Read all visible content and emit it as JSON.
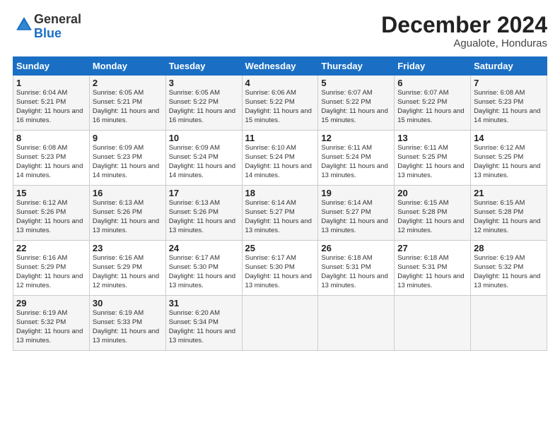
{
  "logo": {
    "general": "General",
    "blue": "Blue"
  },
  "header": {
    "month": "December 2024",
    "location": "Agualote, Honduras"
  },
  "weekdays": [
    "Sunday",
    "Monday",
    "Tuesday",
    "Wednesday",
    "Thursday",
    "Friday",
    "Saturday"
  ],
  "weeks": [
    [
      {
        "day": 1,
        "sunrise": "6:04 AM",
        "sunset": "5:21 PM",
        "daylight": "11 hours and 16 minutes."
      },
      {
        "day": 2,
        "sunrise": "6:05 AM",
        "sunset": "5:21 PM",
        "daylight": "11 hours and 16 minutes."
      },
      {
        "day": 3,
        "sunrise": "6:05 AM",
        "sunset": "5:22 PM",
        "daylight": "11 hours and 16 minutes."
      },
      {
        "day": 4,
        "sunrise": "6:06 AM",
        "sunset": "5:22 PM",
        "daylight": "11 hours and 15 minutes."
      },
      {
        "day": 5,
        "sunrise": "6:07 AM",
        "sunset": "5:22 PM",
        "daylight": "11 hours and 15 minutes."
      },
      {
        "day": 6,
        "sunrise": "6:07 AM",
        "sunset": "5:22 PM",
        "daylight": "11 hours and 15 minutes."
      },
      {
        "day": 7,
        "sunrise": "6:08 AM",
        "sunset": "5:23 PM",
        "daylight": "11 hours and 14 minutes."
      }
    ],
    [
      {
        "day": 8,
        "sunrise": "6:08 AM",
        "sunset": "5:23 PM",
        "daylight": "11 hours and 14 minutes."
      },
      {
        "day": 9,
        "sunrise": "6:09 AM",
        "sunset": "5:23 PM",
        "daylight": "11 hours and 14 minutes."
      },
      {
        "day": 10,
        "sunrise": "6:09 AM",
        "sunset": "5:24 PM",
        "daylight": "11 hours and 14 minutes."
      },
      {
        "day": 11,
        "sunrise": "6:10 AM",
        "sunset": "5:24 PM",
        "daylight": "11 hours and 14 minutes."
      },
      {
        "day": 12,
        "sunrise": "6:11 AM",
        "sunset": "5:24 PM",
        "daylight": "11 hours and 13 minutes."
      },
      {
        "day": 13,
        "sunrise": "6:11 AM",
        "sunset": "5:25 PM",
        "daylight": "11 hours and 13 minutes."
      },
      {
        "day": 14,
        "sunrise": "6:12 AM",
        "sunset": "5:25 PM",
        "daylight": "11 hours and 13 minutes."
      }
    ],
    [
      {
        "day": 15,
        "sunrise": "6:12 AM",
        "sunset": "5:26 PM",
        "daylight": "11 hours and 13 minutes."
      },
      {
        "day": 16,
        "sunrise": "6:13 AM",
        "sunset": "5:26 PM",
        "daylight": "11 hours and 13 minutes."
      },
      {
        "day": 17,
        "sunrise": "6:13 AM",
        "sunset": "5:26 PM",
        "daylight": "11 hours and 13 minutes."
      },
      {
        "day": 18,
        "sunrise": "6:14 AM",
        "sunset": "5:27 PM",
        "daylight": "11 hours and 13 minutes."
      },
      {
        "day": 19,
        "sunrise": "6:14 AM",
        "sunset": "5:27 PM",
        "daylight": "11 hours and 13 minutes."
      },
      {
        "day": 20,
        "sunrise": "6:15 AM",
        "sunset": "5:28 PM",
        "daylight": "11 hours and 12 minutes."
      },
      {
        "day": 21,
        "sunrise": "6:15 AM",
        "sunset": "5:28 PM",
        "daylight": "11 hours and 12 minutes."
      }
    ],
    [
      {
        "day": 22,
        "sunrise": "6:16 AM",
        "sunset": "5:29 PM",
        "daylight": "11 hours and 12 minutes."
      },
      {
        "day": 23,
        "sunrise": "6:16 AM",
        "sunset": "5:29 PM",
        "daylight": "11 hours and 12 minutes."
      },
      {
        "day": 24,
        "sunrise": "6:17 AM",
        "sunset": "5:30 PM",
        "daylight": "11 hours and 13 minutes."
      },
      {
        "day": 25,
        "sunrise": "6:17 AM",
        "sunset": "5:30 PM",
        "daylight": "11 hours and 13 minutes."
      },
      {
        "day": 26,
        "sunrise": "6:18 AM",
        "sunset": "5:31 PM",
        "daylight": "11 hours and 13 minutes."
      },
      {
        "day": 27,
        "sunrise": "6:18 AM",
        "sunset": "5:31 PM",
        "daylight": "11 hours and 13 minutes."
      },
      {
        "day": 28,
        "sunrise": "6:19 AM",
        "sunset": "5:32 PM",
        "daylight": "11 hours and 13 minutes."
      }
    ],
    [
      {
        "day": 29,
        "sunrise": "6:19 AM",
        "sunset": "5:32 PM",
        "daylight": "11 hours and 13 minutes."
      },
      {
        "day": 30,
        "sunrise": "6:19 AM",
        "sunset": "5:33 PM",
        "daylight": "11 hours and 13 minutes."
      },
      {
        "day": 31,
        "sunrise": "6:20 AM",
        "sunset": "5:34 PM",
        "daylight": "11 hours and 13 minutes."
      },
      null,
      null,
      null,
      null
    ]
  ]
}
